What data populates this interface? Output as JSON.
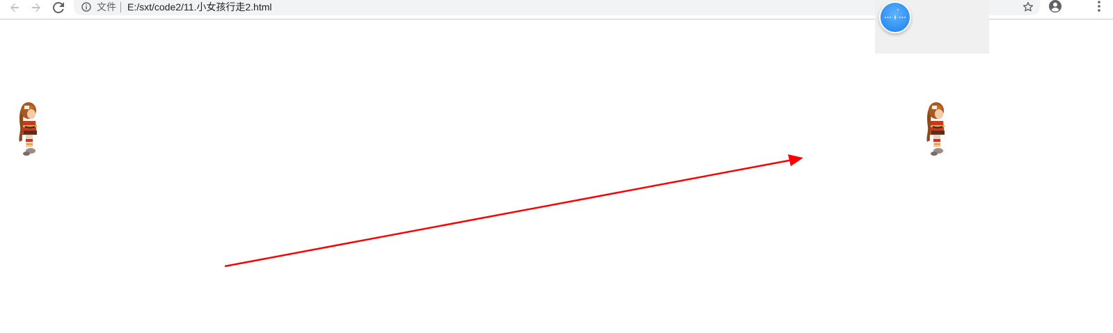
{
  "browser": {
    "back_icon": "arrow-left-icon",
    "forward_icon": "arrow-right-icon",
    "reload_icon": "reload-icon",
    "info_icon": "info-icon",
    "scheme_label": "文件",
    "url": "E:/sxt/code2/11.小女孩行走2.html",
    "bookmark_icon": "star-icon",
    "profile_icon": "account-circle-icon",
    "menu_icon": "more-vert-icon"
  },
  "overlay": {
    "float_ball_icon": "assistive-float-ball-icon"
  },
  "page": {
    "sprites": [
      {
        "name": "girl-sprite-left",
        "pose": "walking-girl"
      },
      {
        "name": "girl-sprite-right",
        "pose": "walking-girl"
      }
    ],
    "annotation": {
      "type": "arrow",
      "color": "#ff0000",
      "direction": "left-to-right, upward"
    }
  },
  "colors": {
    "arrow": "#ff0000",
    "toolbar_bg": "#ffffff",
    "omnibox_bg": "#f1f3f4",
    "icon_gray": "#5f6368",
    "float_ball": "#2e8ef3"
  }
}
